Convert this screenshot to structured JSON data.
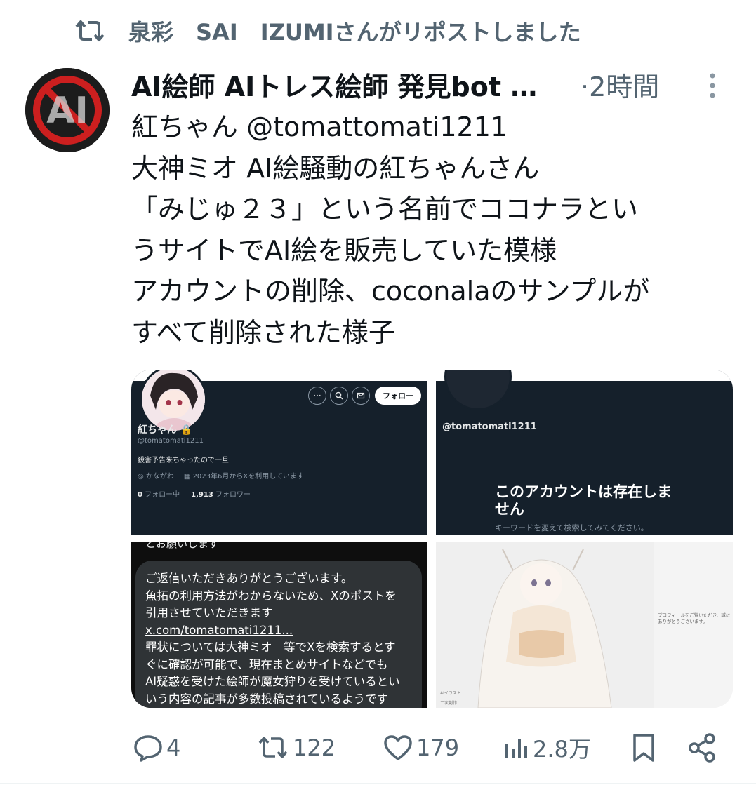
{
  "repost": {
    "label": "泉彩　SAI　IZUMIさんがリポストしました",
    "icon": "repost-icon"
  },
  "author": {
    "display_name": "AI絵師 AIトレス絵師 発見bot …",
    "time": "·2時間",
    "avatar_text": "AI"
  },
  "tweet": {
    "text": "紅ちゃん @tomattomati1211\n大神ミオ AI絵騒動の紅ちゃんさん\n「みじゅ２３」という名前でココナラとい\nうサイトでAI絵を販売していた模様\nアカウントの削除、coconalaのサンプルが\nすべて削除された様子"
  },
  "media": {
    "profile": {
      "follow_label": "フォロー",
      "name": "紅ちゃん 🔒",
      "handle": "@tomatomati1211",
      "bio": "殺害予告来ちゃったので一旦",
      "location": "◎ かながわ",
      "joined": "▦ 2023年6月からXを利用しています",
      "following_count": "0",
      "following_label": "フォロー中",
      "followers_count": "1,913",
      "followers_label": "フォロワー"
    },
    "deleted": {
      "handle": "@tomatomati1211",
      "title": "このアカウントは存在しません",
      "subtitle": "キーワードを変えて検索してみてください。"
    },
    "message": {
      "prev_line": "とお願いします",
      "body_1": "ご返信いただきありがとうございます。\n魚拓の利用方法がわからないため、Xのポストを\n引用させていただきます\n",
      "link": "x.com/tomatomati1211...",
      "body_2": "\n罪状については大神ミオ　等でXを検索するとす\nぐに確認が可能で、現在まとめサイトなどでも\nAI疑惑を受けた絵師が魔女狩りを受けているとい\nいう内容の記事が多数投稿されているようです"
    },
    "listing": {
      "side_text": "プロフィールをご覧いただき、誠にありがとうございます。\n",
      "row_1": "AIイラスト",
      "row_2": "二次創作"
    }
  },
  "actions": {
    "reply_count": "4",
    "repost_count": "122",
    "like_count": "179",
    "views_count": "2.8万"
  },
  "colors": {
    "text": "#0f1419",
    "secondary": "#536471",
    "dark_bg": "#15202b"
  }
}
